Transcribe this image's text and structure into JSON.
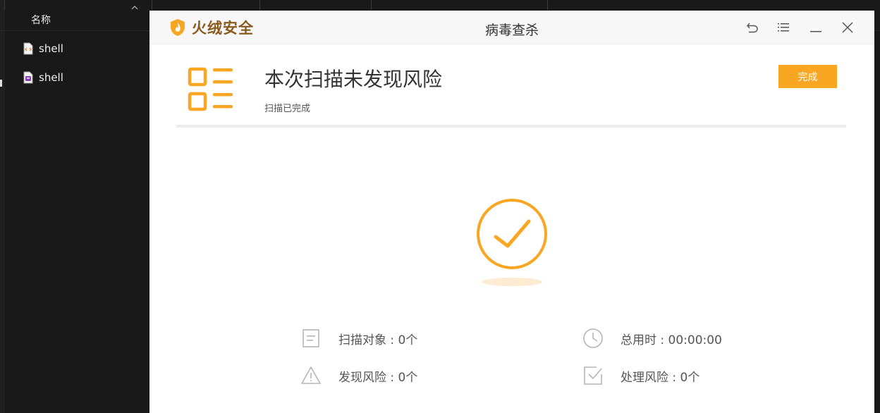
{
  "explorer": {
    "column_header": "名称",
    "files": [
      {
        "name": "shell",
        "icon": "code-file-icon"
      },
      {
        "name": "shell",
        "icon": "script-file-icon"
      }
    ]
  },
  "app": {
    "brand": "火绒安全",
    "window_title": "病毒查杀",
    "accent_color": "#f9a623",
    "brand_color": "#8a5a1c",
    "controls": [
      "back-icon",
      "menu-icon",
      "minimize-icon",
      "close-icon"
    ]
  },
  "result": {
    "title": "本次扫描未发现风险",
    "subtitle": "扫描已完成",
    "done_label": "完成"
  },
  "stats": {
    "scanned": "扫描对象 : 0个",
    "duration": "总用时 : 00:00:00",
    "found": "发现风险 : 0个",
    "handled": "处理风险 : 0个"
  }
}
